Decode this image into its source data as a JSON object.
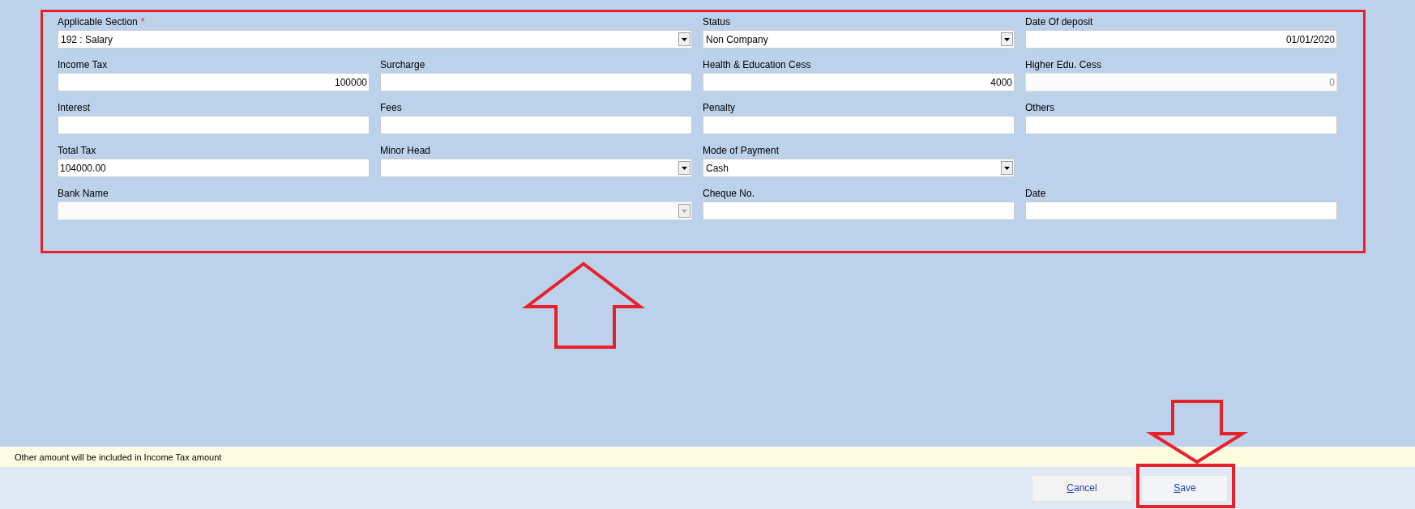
{
  "form": {
    "rows": [
      [
        {
          "label": "Applicable Section",
          "required_mark": "*",
          "kind": "select",
          "value": "192 : Salary",
          "wide": true,
          "disabled": false
        },
        {
          "label": "Status",
          "kind": "select",
          "value": "Non Company",
          "wide": false,
          "disabled": false
        },
        {
          "label": "Date Of deposit",
          "kind": "number",
          "value": "01/01/2020",
          "wide": false,
          "disabled": false
        }
      ],
      [
        {
          "label": "Income Tax",
          "kind": "number",
          "value": "100000",
          "wide": false,
          "disabled": false
        },
        {
          "label": "Surcharge",
          "kind": "number",
          "wide": false,
          "disabled": false
        },
        {
          "label": "Health & Education Cess",
          "kind": "number",
          "value": "4000",
          "wide": false,
          "disabled": false
        },
        {
          "label": "Higher Edu. Cess",
          "kind": "number",
          "value": "0",
          "wide": false,
          "disabled": true
        }
      ],
      [
        {
          "label": "Interest",
          "kind": "number",
          "wide": false,
          "disabled": false
        },
        {
          "label": "Fees",
          "kind": "number",
          "wide": false,
          "disabled": false
        },
        {
          "label": "Penalty",
          "kind": "number",
          "wide": false,
          "disabled": false
        },
        {
          "label": "Others",
          "kind": "number",
          "wide": false,
          "disabled": false
        }
      ],
      [
        {
          "label": "Total Tax",
          "kind": "text",
          "value": "104000.00",
          "wide": false,
          "disabled": false
        },
        {
          "label": "Minor Head",
          "kind": "select",
          "wide": false,
          "disabled": false
        },
        {
          "label": "Mode of Payment",
          "kind": "select",
          "value": "Cash",
          "wide": false,
          "disabled": false
        }
      ],
      [
        {
          "label": "Bank Name",
          "kind": "select",
          "wide": true,
          "disabled": true
        },
        {
          "label": "Cheque No.",
          "kind": "text",
          "wide": false,
          "disabled": false
        },
        {
          "label": "Date",
          "kind": "text",
          "wide": false,
          "disabled": false
        }
      ]
    ]
  },
  "info_bar": "Other amount will be included in Income Tax amount",
  "buttons": [
    {
      "label": "Cancel",
      "highlighted": false
    },
    {
      "label": "Save",
      "highlighted": true
    }
  ]
}
